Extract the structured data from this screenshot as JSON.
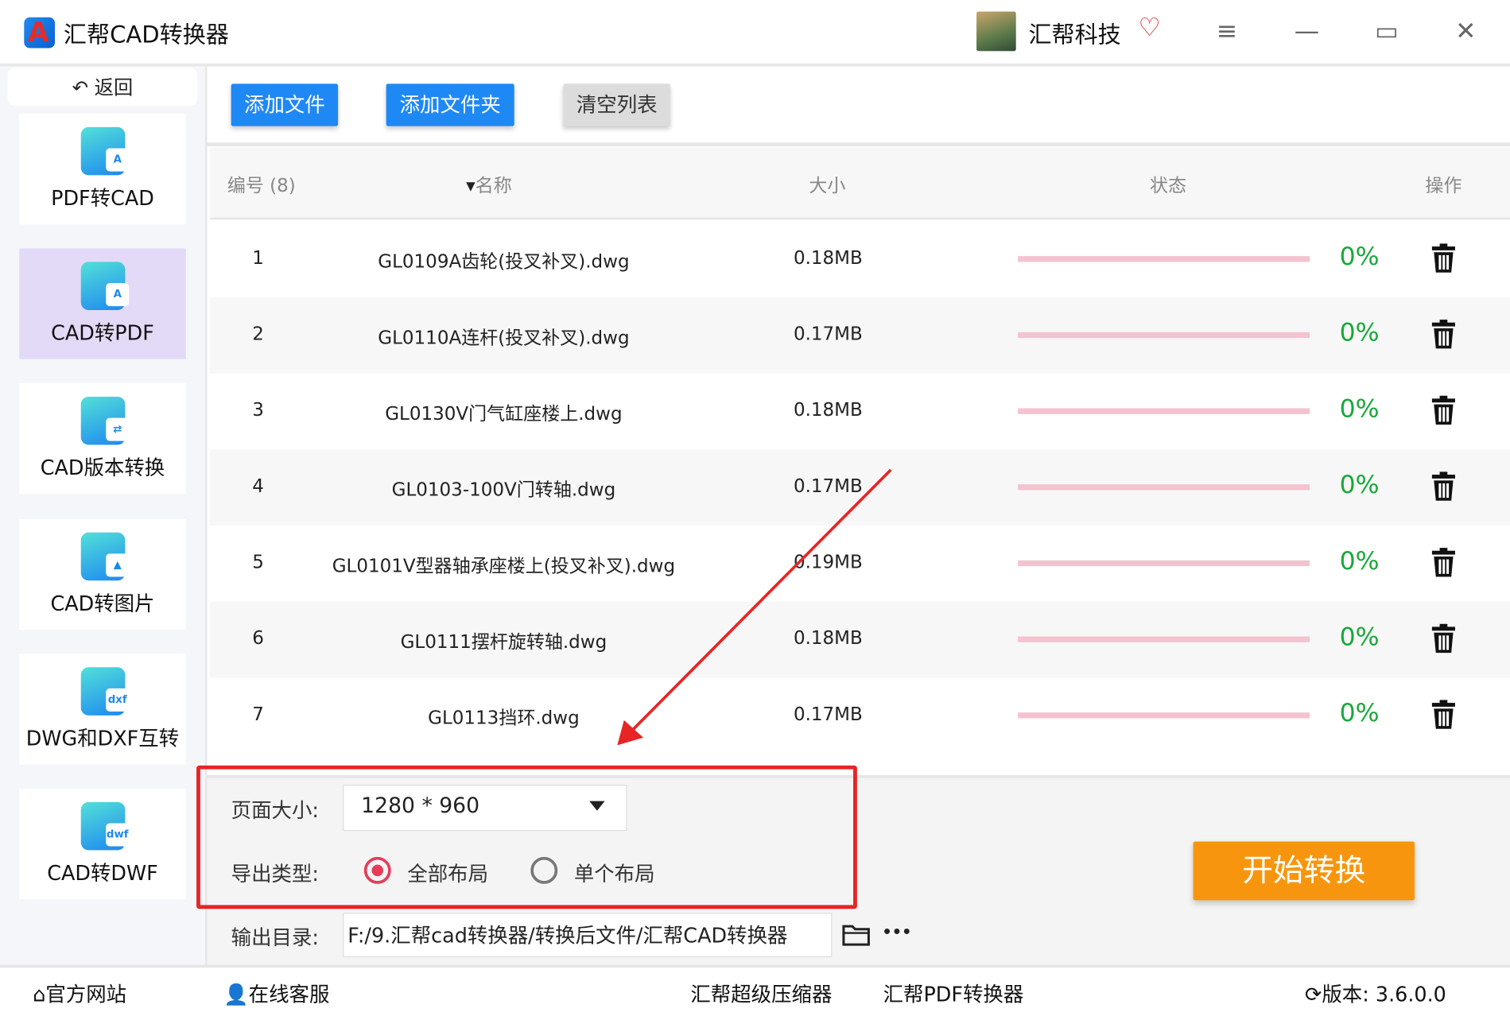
{
  "app": {
    "title": "汇帮CAD转换器",
    "logo_letter": "A",
    "brand": "汇帮科技"
  },
  "window": {
    "menu_icon": "≡",
    "minimize_icon": "—",
    "maximize_icon": "▭",
    "close_icon": "✕"
  },
  "sidebar": {
    "back_label": "返回",
    "back_icon": "↶",
    "items": [
      {
        "label": "PDF转CAD",
        "badge": "A"
      },
      {
        "label": "CAD转PDF",
        "badge": "A",
        "active": true
      },
      {
        "label": "CAD版本转换",
        "badge": "⇄"
      },
      {
        "label": "CAD转图片",
        "badge": "▲"
      },
      {
        "label": "DWG和DXF互转",
        "badge": "dxf"
      },
      {
        "label": "CAD转DWF",
        "badge": "dwf"
      }
    ]
  },
  "toolbar": {
    "add_file": "添加文件",
    "add_folder": "添加文件夹",
    "clear_list": "清空列表"
  },
  "table": {
    "headers": {
      "index": "编号 (8)",
      "name": "名称",
      "size": "大小",
      "status": "状态",
      "action": "操作"
    },
    "rows": [
      {
        "index": "1",
        "name": "GL0109A齿轮(投叉补叉).dwg",
        "size": "0.18MB",
        "progress": "0%"
      },
      {
        "index": "2",
        "name": "GL0110A连杆(投叉补叉).dwg",
        "size": "0.17MB",
        "progress": "0%"
      },
      {
        "index": "3",
        "name": "GL0130V门气缸座楼上.dwg",
        "size": "0.18MB",
        "progress": "0%"
      },
      {
        "index": "4",
        "name": "GL0103-100V门转轴.dwg",
        "size": "0.17MB",
        "progress": "0%"
      },
      {
        "index": "5",
        "name": "GL0101V型器轴承座楼上(投叉补叉).dwg",
        "size": "0.19MB",
        "progress": "0%"
      },
      {
        "index": "6",
        "name": "GL0111摆杆旋转轴.dwg",
        "size": "0.18MB",
        "progress": "0%"
      },
      {
        "index": "7",
        "name": "GL0113挡环.dwg",
        "size": "0.17MB",
        "progress": "0%"
      }
    ]
  },
  "settings": {
    "page_size_label": "页面大小:",
    "page_size_value": "1280 * 960",
    "export_type_label": "导出类型:",
    "option_all": "全部布局",
    "option_single": "单个布局",
    "output_label": "输出目录:",
    "output_path": "F:/9.汇帮cad转换器/转换后文件/汇帮CAD转换器",
    "more_icon": "•••"
  },
  "start_button": "开始转换",
  "footer": {
    "website": "官方网站",
    "support": "在线客服",
    "compressor": "汇帮超级压缩器",
    "pdf_converter": "汇帮PDF转换器",
    "version": "版本:  3.6.0.0"
  },
  "colors": {
    "accent_blue": "#1e88f5",
    "start_orange": "#f7960e",
    "progress_green": "#1aa83a",
    "highlight_red": "#e82424"
  }
}
